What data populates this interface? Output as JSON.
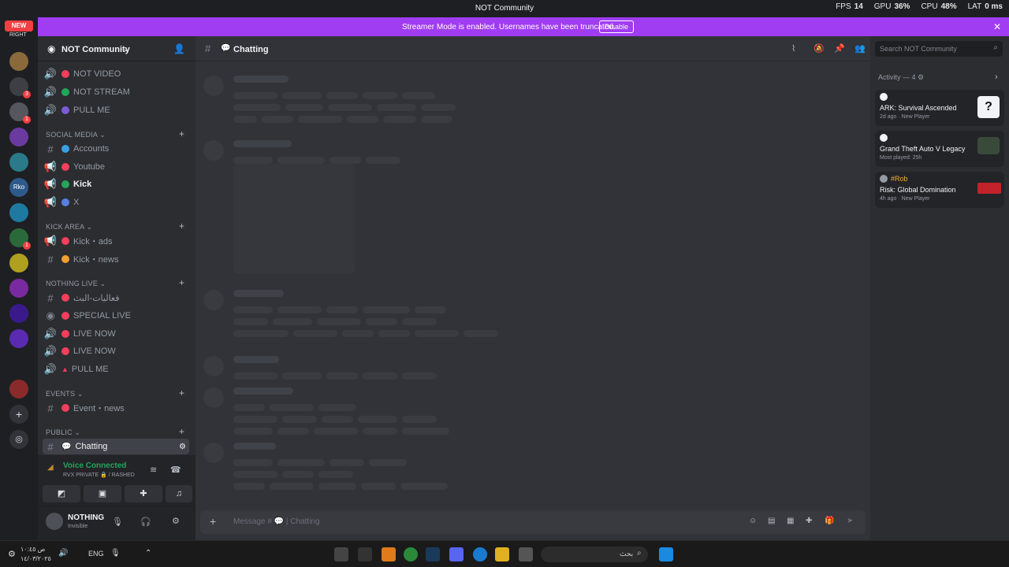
{
  "window": {
    "title": "NOT Community",
    "overlay": {
      "fps_label": "FPS",
      "fps": "14",
      "gpu_label": "GPU",
      "gpu": "36%",
      "cpu_label": "CPU",
      "cpu": "48%",
      "lat_label": "LAT",
      "lat": "0 ms"
    }
  },
  "rail": {
    "new_badge": "NEW",
    "top_label": "RIGHT",
    "rko_label": "Rko"
  },
  "banner": {
    "text": "Streamer Mode is enabled. Usernames have been truncated.",
    "button": "Disable"
  },
  "server": {
    "name": "NOT Community"
  },
  "channels": {
    "top": [
      {
        "name": "NOT VIDEO",
        "color": "#f23f5c"
      },
      {
        "name": "NOT STREAM",
        "color": "#23a55a"
      },
      {
        "name": "PULL ME",
        "color": "#7b5cd6"
      }
    ],
    "social_label": "SOCIAL MEDIA",
    "social": [
      {
        "name": "Accounts",
        "color": "#3aa0e3"
      },
      {
        "name": "Youtube",
        "color": "#f23f5c"
      },
      {
        "name": "Kick",
        "color": "#23a55a"
      },
      {
        "name": "X",
        "color": "#5a7de0"
      }
    ],
    "kick_label": "KICK AREA",
    "kick": [
      {
        "name": "Kick・ads",
        "color": "#f23f5c"
      },
      {
        "name": "Kick・news",
        "color": "#f0a030"
      }
    ],
    "live_label": "NOTHING LIVE",
    "live": [
      {
        "name": "فعاليات-البث",
        "color": "#f23f5c"
      },
      {
        "name": "SPECIAL LIVE",
        "color": "#f23f5c"
      },
      {
        "name": "LIVE NOW",
        "color": "#f23f5c"
      },
      {
        "name": "LIVE NOW",
        "color": "#f23f5c"
      },
      {
        "name": "PULL ME",
        "color": "#f23f5c"
      }
    ],
    "events_label": "EVENTS",
    "events": [
      {
        "name": "Event・news",
        "color": "#f23f5c"
      }
    ],
    "public_label": "PUBLIC",
    "public": [
      {
        "name": "Chatting",
        "color": "#dbdee1"
      }
    ]
  },
  "voice": {
    "status": "Voice Connected",
    "location": "RVX PRIVATE 🔒 / RASHED"
  },
  "user": {
    "name": "NOTHING",
    "status": "Invisible"
  },
  "chat": {
    "channel": "Chatting",
    "placeholder": "Message # 💬 | Chatting"
  },
  "activity": {
    "search_placeholder": "Search NOT Community",
    "header": "Activity — 4",
    "cards": [
      {
        "user": "",
        "game": "ARK: Survival Ascended",
        "meta": "2d ago",
        "tag": "New Player"
      },
      {
        "user": "",
        "game": "Grand Theft Auto V Legacy",
        "meta": "Most played: 25h",
        "tag": ""
      },
      {
        "user": "#Rob",
        "game": "Risk: Global Domination",
        "meta": "4h ago",
        "tag": "New Player"
      }
    ]
  },
  "taskbar": {
    "lang": "ENG",
    "search_text": "بحث",
    "time": "ص ١٠:٤٥",
    "date": "١٤/٠٣/٢٠٢٥"
  }
}
